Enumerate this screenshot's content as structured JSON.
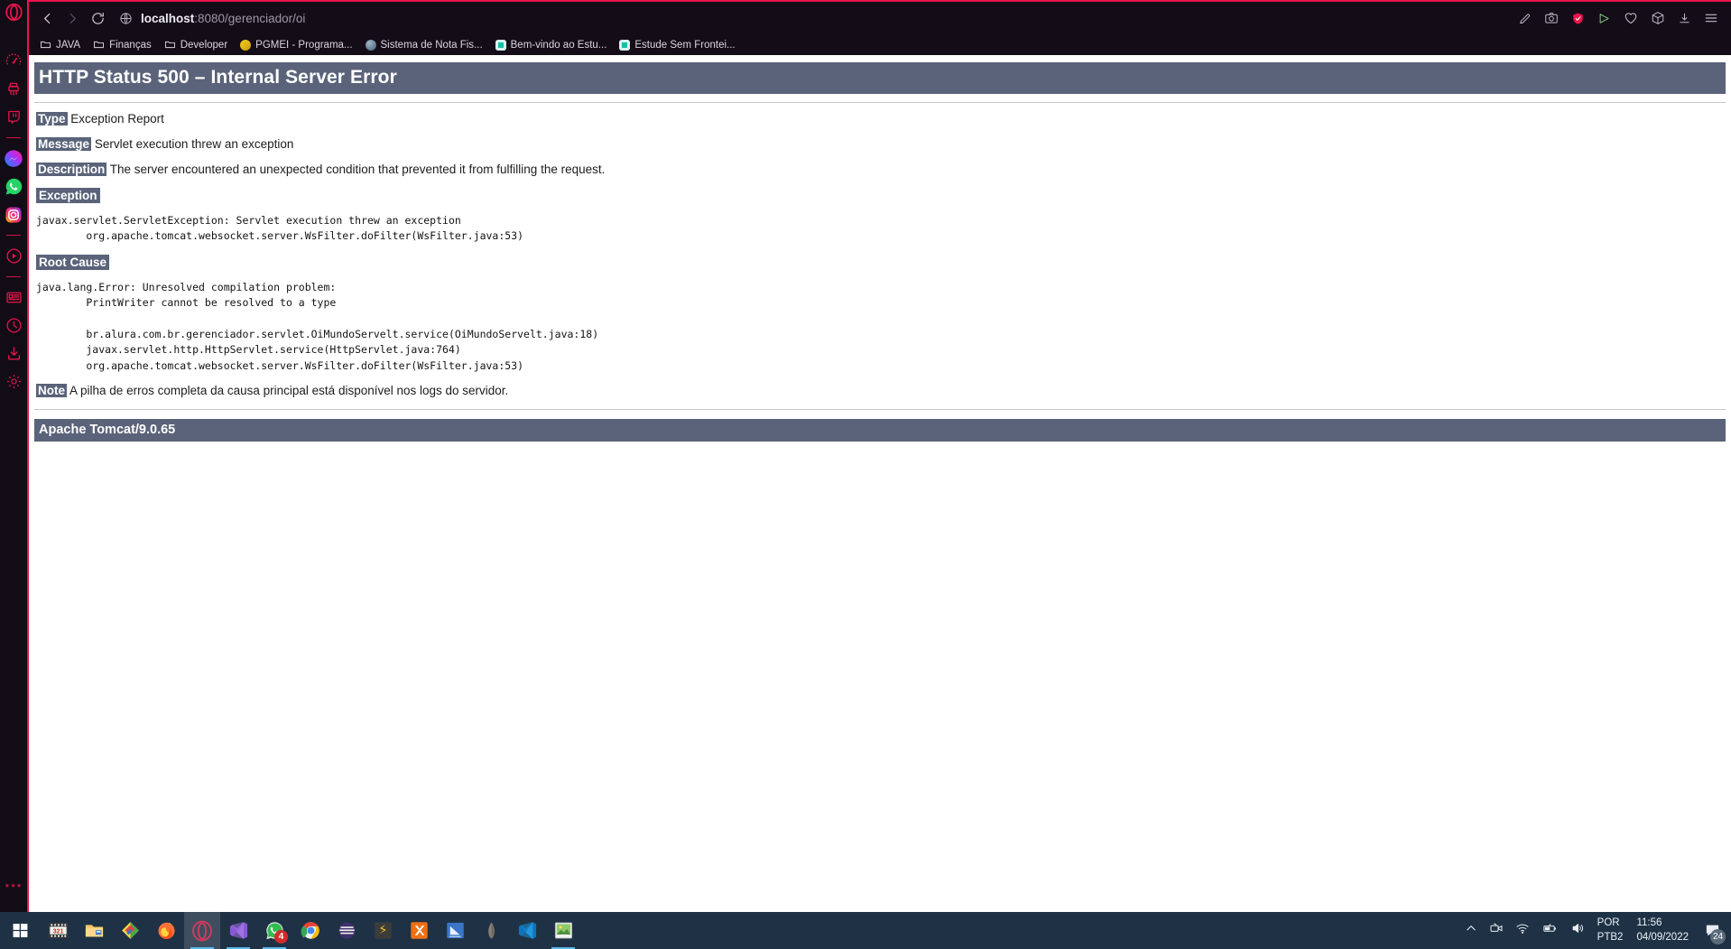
{
  "sidebar": {
    "items": [
      {
        "name": "opera-gx-logo-icon",
        "label": "Opera GX"
      },
      {
        "name": "gx-control-icon",
        "label": "GX Control"
      },
      {
        "name": "gx-cleaner-icon",
        "label": "GX Cleaner"
      },
      {
        "name": "twitch-icon",
        "label": "Twitch"
      },
      {
        "name": "messenger-icon",
        "label": "Messenger"
      },
      {
        "name": "whatsapp-icon",
        "label": "WhatsApp"
      },
      {
        "name": "instagram-icon",
        "label": "Instagram"
      },
      {
        "name": "player-icon",
        "label": "Player"
      },
      {
        "name": "news-icon",
        "label": "News"
      },
      {
        "name": "history-icon",
        "label": "History"
      },
      {
        "name": "downloads-icon",
        "label": "Downloads"
      },
      {
        "name": "settings-icon",
        "label": "Easy Setup"
      }
    ],
    "more_label": "•••"
  },
  "browser": {
    "back_label": "Back",
    "forward_label": "Forward",
    "reload_label": "Reload",
    "address": {
      "host": "localhost",
      "path": ":8080/gerenciador/oi",
      "full": "localhost:8080/gerenciador/oi"
    },
    "right_icons": [
      {
        "name": "edit-icon",
        "label": "Edit"
      },
      {
        "name": "snapshot-icon",
        "label": "Snapshot"
      },
      {
        "name": "shield-icon",
        "label": "Ad blocker"
      },
      {
        "name": "flow-icon",
        "label": "Flow"
      },
      {
        "name": "heart-icon",
        "label": "Favorites"
      },
      {
        "name": "extensions-icon",
        "label": "Extensions"
      },
      {
        "name": "downloads-icon",
        "label": "Downloads"
      },
      {
        "name": "menu-icon",
        "label": "Menu"
      }
    ],
    "bookmarks": [
      {
        "label": "JAVA",
        "icon": "folder-icon"
      },
      {
        "label": "Finanças",
        "icon": "folder-icon"
      },
      {
        "label": "Developer",
        "icon": "folder-icon"
      },
      {
        "label": "PGMEI - Programa...",
        "icon": "favicon-yellow"
      },
      {
        "label": "Sistema de Nota Fis...",
        "icon": "favicon-globe"
      },
      {
        "label": "Bem-vindo ao Estu...",
        "icon": "favicon-teal"
      },
      {
        "label": "Estude Sem Frontei...",
        "icon": "favicon-teal2"
      }
    ]
  },
  "error_page": {
    "title": "HTTP Status 500 – Internal Server Error",
    "rows": [
      {
        "tag": "Type",
        "text": "Exception Report"
      },
      {
        "tag": "Message",
        "text": "Servlet execution threw an exception"
      },
      {
        "tag": "Description",
        "text": "The server encountered an unexpected condition that prevented it from fulfilling the request."
      }
    ],
    "exception_heading": "Exception",
    "exception_trace": "javax.servlet.ServletException: Servlet execution threw an exception\n        org.apache.tomcat.websocket.server.WsFilter.doFilter(WsFilter.java:53)",
    "root_cause_heading": "Root Cause",
    "root_cause_trace": "java.lang.Error: Unresolved compilation problem: \n        PrintWriter cannot be resolved to a type\n\n        br.alura.com.br.gerenciador.servlet.OiMundoServelt.service(OiMundoServelt.java:18)\n        javax.servlet.http.HttpServlet.service(HttpServlet.java:764)\n        org.apache.tomcat.websocket.server.WsFilter.doFilter(WsFilter.java:53)",
    "note_tag": "Note",
    "note_text": "A pilha de erros completa da causa principal está disponível nos logs do servidor.",
    "footer": "Apache Tomcat/9.0.65",
    "colors": {
      "banner_bg": "#5a6379",
      "banner_fg": "#ffffff",
      "page_bg": "#ffffff",
      "text": "#1c1c1c"
    }
  },
  "taskbar": {
    "start_label": "Start",
    "apps": [
      {
        "name": "taskbar-app-movie-maker",
        "label": "Video Editor"
      },
      {
        "name": "taskbar-app-file-explorer",
        "label": "File Explorer"
      },
      {
        "name": "taskbar-app-paint-net",
        "label": "Paint.NET"
      },
      {
        "name": "taskbar-app-firefox",
        "label": "Firefox"
      },
      {
        "name": "taskbar-app-opera-gx",
        "label": "Opera GX"
      },
      {
        "name": "taskbar-app-visual-studio",
        "label": "Visual Studio"
      },
      {
        "name": "taskbar-app-whatsapp",
        "label": "WhatsApp",
        "badge": "4"
      },
      {
        "name": "taskbar-app-chrome",
        "label": "Google Chrome"
      },
      {
        "name": "taskbar-app-eclipse",
        "label": "Eclipse"
      },
      {
        "name": "taskbar-app-sublime-text",
        "label": "Sublime Text"
      },
      {
        "name": "taskbar-app-xampp",
        "label": "XAMPP"
      },
      {
        "name": "taskbar-app-snipping-tool",
        "label": "Snipping Tool"
      },
      {
        "name": "taskbar-app-gimp",
        "label": "GIMP"
      },
      {
        "name": "taskbar-app-vscode",
        "label": "Visual Studio Code"
      },
      {
        "name": "taskbar-app-photos",
        "label": "Photos"
      }
    ],
    "tray": {
      "show_hidden_label": "Show hidden icons",
      "icons": [
        {
          "name": "camera-icon",
          "label": "Camera"
        },
        {
          "name": "wifi-icon",
          "label": "Network"
        },
        {
          "name": "battery-icon",
          "label": "Battery"
        },
        {
          "name": "volume-icon",
          "label": "Volume"
        }
      ],
      "language": "POR",
      "keyboard": "PTB2",
      "time": "11:56",
      "date": "04/09/2022",
      "notification_count": "24"
    }
  }
}
